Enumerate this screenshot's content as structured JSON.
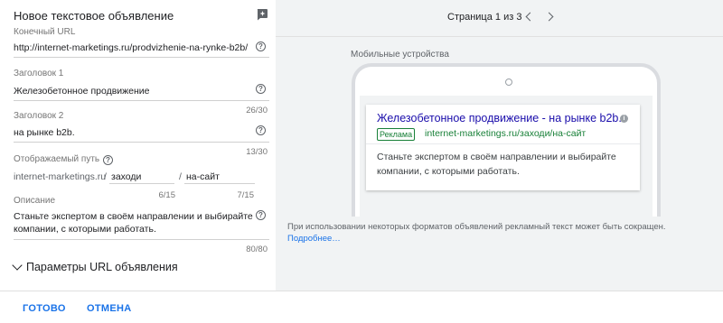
{
  "form": {
    "title": "Новое текстовое объявление",
    "final_url": {
      "label": "Конечный URL",
      "value": "http://internet-marketings.ru/prodvizhenie-na-rynke-b2b/"
    },
    "headline1": {
      "label": "Заголовок 1",
      "value": "Железобетонное продвижение",
      "counter": "26/30"
    },
    "headline2": {
      "label": "Заголовок 2",
      "value": "на рынке b2b.",
      "counter": "13/30"
    },
    "display_path": {
      "label": "Отображаемый путь",
      "base": "internet-marketings.ru",
      "sep": "/",
      "path1": "заходи",
      "path1_counter": "6/15",
      "path2": "на-сайт",
      "path2_counter": "7/15"
    },
    "description": {
      "label": "Описание",
      "line1": "Станьте экспертом в своём направлении и выбирайте",
      "line2": "компании, с которыми работать.",
      "counter": "80/80"
    },
    "url_params_label": "Параметры URL объявления"
  },
  "footer": {
    "done_label": "ГОТОВО",
    "cancel_label": "ОТМЕНА"
  },
  "preview": {
    "page_indicator": "Страница 1 из 3",
    "device_label": "Мобильные устройства",
    "ad": {
      "headline": "Железобетонное продвижение - на рынке b2b.",
      "badge": "Реклама",
      "display_url": "internet-marketings.ru/заходи/на-сайт",
      "description_line1": "Станьте экспертом в своём направлении и выбирайте",
      "description_line2": "компании, с которыми работать."
    },
    "disclaimer": "При использовании некоторых форматов объявлений рекламный текст может быть сокращен.",
    "more_link": "Подробнее…"
  },
  "colors": {
    "accent": "#1a73e8",
    "ad_headline": "#1a0dab",
    "ad_url": "#188038",
    "preview_bg": "#f1f3f4"
  }
}
